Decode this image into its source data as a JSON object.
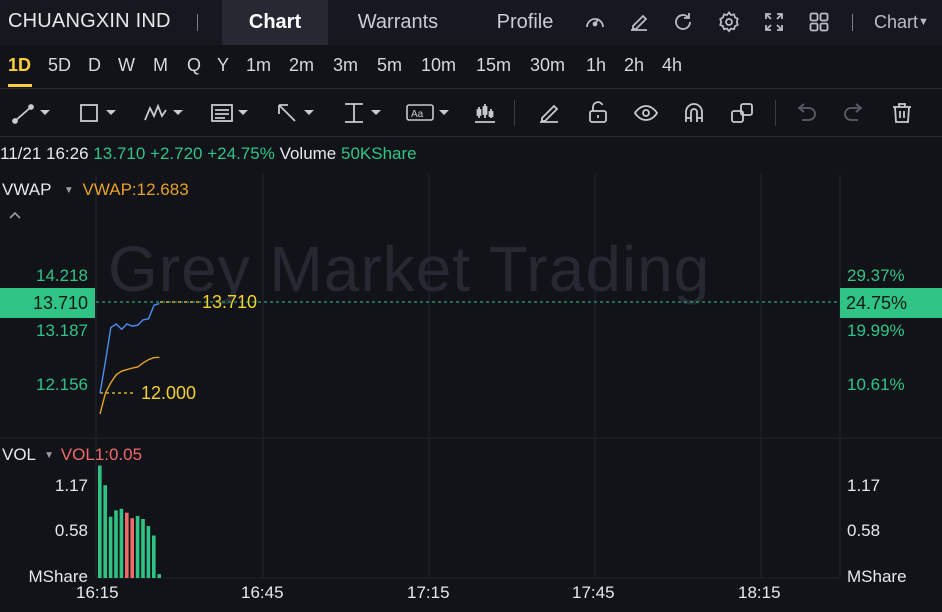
{
  "header": {
    "stock_name": "CHUANGXIN IND",
    "tabs": [
      {
        "label": "Chart",
        "active": true
      },
      {
        "label": "Warrants",
        "active": false
      },
      {
        "label": "Profile",
        "active": false
      }
    ],
    "icons": [
      "gauge-icon",
      "edit-icon",
      "refresh-icon",
      "settings-icon",
      "fullscreen-icon",
      "grid-icon"
    ],
    "chart_menu_label": "Chart"
  },
  "timeframes": [
    "1D",
    "5D",
    "D",
    "W",
    "M",
    "Q",
    "Y",
    "1m",
    "2m",
    "3m",
    "5m",
    "10m",
    "15m",
    "30m",
    "1h",
    "2h",
    "4h"
  ],
  "active_timeframe": "1D",
  "drawing_tools": [
    "line-tool",
    "rectangle-tool",
    "pattern-tool",
    "fib-tool",
    "arrow-tool",
    "measure-tool",
    "text-tool",
    "indicator-tool",
    "pen-tool",
    "lock-icon",
    "eye-icon",
    "magnet-icon",
    "link-icon",
    "undo-icon",
    "redo-icon",
    "trash-icon"
  ],
  "quote": {
    "datetime": "11/21 16:26",
    "price": "13.710",
    "change": "+2.720",
    "change_pct": "+24.75%",
    "volume_label": "Volume",
    "volume_value": "50KShare"
  },
  "price_panel": {
    "indicator": "VWAP",
    "indicator_value": "VWAP:12.683",
    "watermark": "Grey Market Trading",
    "left_ticks": [
      "14.218",
      "13.187",
      "12.156"
    ],
    "right_ticks": [
      "29.37%",
      "19.99%",
      "10.61%"
    ],
    "current_price_tag": "13.710",
    "current_pct_tag": "24.75%",
    "last_price_label": "13.710",
    "open_price_label": "12.000"
  },
  "volume_panel": {
    "indicator": "VOL",
    "indicator_value": "VOL1:0.05",
    "left_ticks": [
      "1.17",
      "0.58",
      "MShare"
    ],
    "right_ticks": [
      "1.17",
      "0.58",
      "MShare"
    ]
  },
  "time_axis": [
    "16:15",
    "16:45",
    "17:15",
    "17:45",
    "18:15"
  ],
  "colors": {
    "up": "#2fc486",
    "down": "#f06a6a",
    "vwap": "#e8a129",
    "price_line": "#4a8ff0",
    "accent": "#ffce3c"
  },
  "chart_data": [
    {
      "type": "line",
      "title": "",
      "ylim": [
        11.6,
        14.6
      ],
      "series": [
        {
          "name": "",
          "x": [
            "16:15",
            "16:16",
            "16:17",
            "16:18",
            "16:19",
            "16:20",
            "16:21",
            "16:22",
            "16:23",
            "16:24",
            "16:25",
            "16:26"
          ],
          "values": [
            12.0,
            12.6,
            13.25,
            13.32,
            13.22,
            13.32,
            13.28,
            13.3,
            13.4,
            13.42,
            13.68,
            13.71
          ]
        },
        {
          "name": "VWAP",
          "x": [
            "16:15",
            "16:16",
            "16:17",
            "16:18",
            "16:19",
            "16:20",
            "16:21",
            "16:22",
            "16:23",
            "16:24",
            "16:25",
            "16:26"
          ],
          "values": [
            11.6,
            12.0,
            12.2,
            12.35,
            12.42,
            12.45,
            12.48,
            12.5,
            12.58,
            12.64,
            12.68,
            12.683
          ]
        }
      ]
    },
    {
      "type": "bar",
      "title": "",
      "ylabel": "MShare",
      "ylim": [
        0,
        1.45
      ],
      "x": [
        "16:15",
        "16:16",
        "16:17",
        "16:18",
        "16:19",
        "16:20",
        "16:21",
        "16:22",
        "16:23",
        "16:24",
        "16:25",
        "16:26"
      ],
      "values": [
        1.43,
        1.18,
        0.78,
        0.86,
        0.88,
        0.83,
        0.76,
        0.79,
        0.75,
        0.66,
        0.54,
        0.05
      ],
      "direction": [
        "up",
        "up",
        "up",
        "up",
        "up",
        "down",
        "down",
        "up",
        "up",
        "up",
        "up",
        "up"
      ]
    }
  ]
}
